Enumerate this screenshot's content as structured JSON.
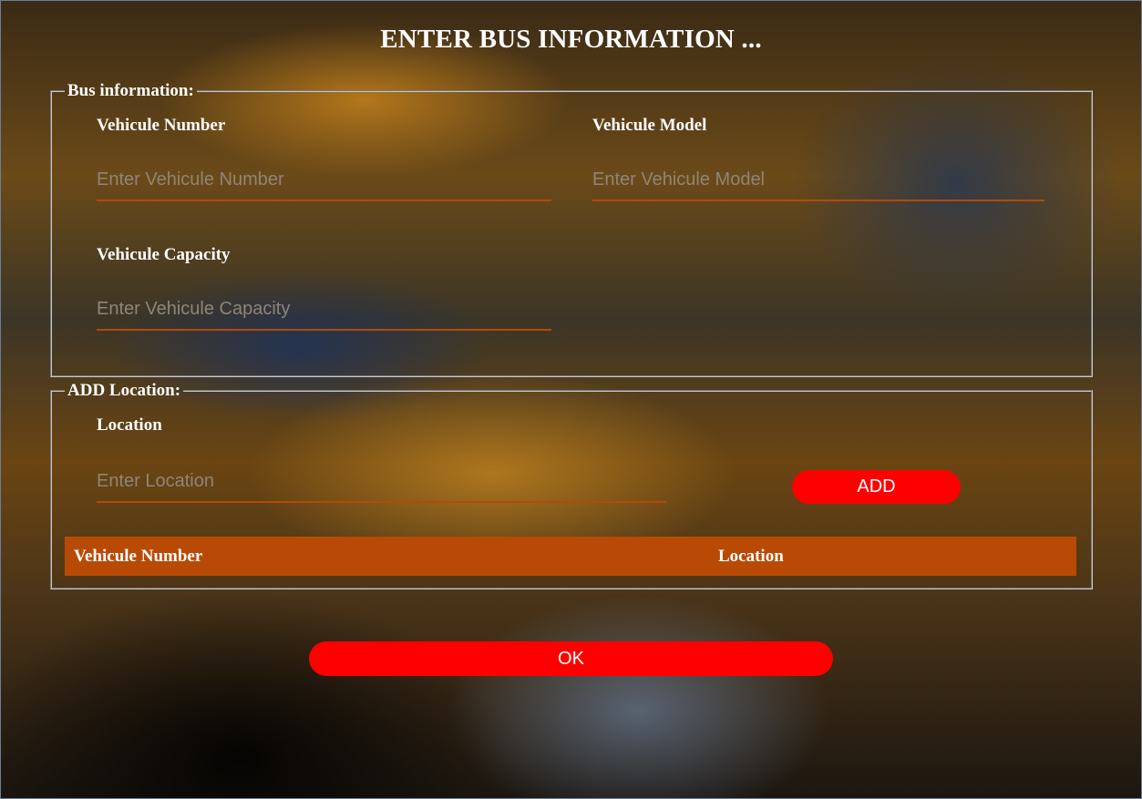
{
  "page": {
    "title": "ENTER BUS INFORMATION ..."
  },
  "bus_info": {
    "legend": "Bus information:",
    "vehicle_number": {
      "label": "Vehicule Number",
      "placeholder": "Enter Vehicule Number",
      "value": ""
    },
    "vehicle_model": {
      "label": "Vehicule Model",
      "placeholder": "Enter Vehicule Model",
      "value": ""
    },
    "vehicle_capacity": {
      "label": "Vehicule Capacity",
      "placeholder": "Enter Vehicule Capacity",
      "value": ""
    }
  },
  "add_location": {
    "legend": "ADD Location:",
    "location": {
      "label": "Location",
      "placeholder": "Enter Location",
      "value": ""
    },
    "add_button_label": "ADD",
    "table": {
      "columns": [
        "Vehicule Number",
        "Location"
      ],
      "rows": []
    }
  },
  "footer": {
    "ok_button_label": "OK"
  },
  "colors": {
    "accent_button": "#ff0000",
    "table_header_bg": "#b94a06",
    "input_underline": "#b34a0a",
    "text": "#ffffff"
  }
}
